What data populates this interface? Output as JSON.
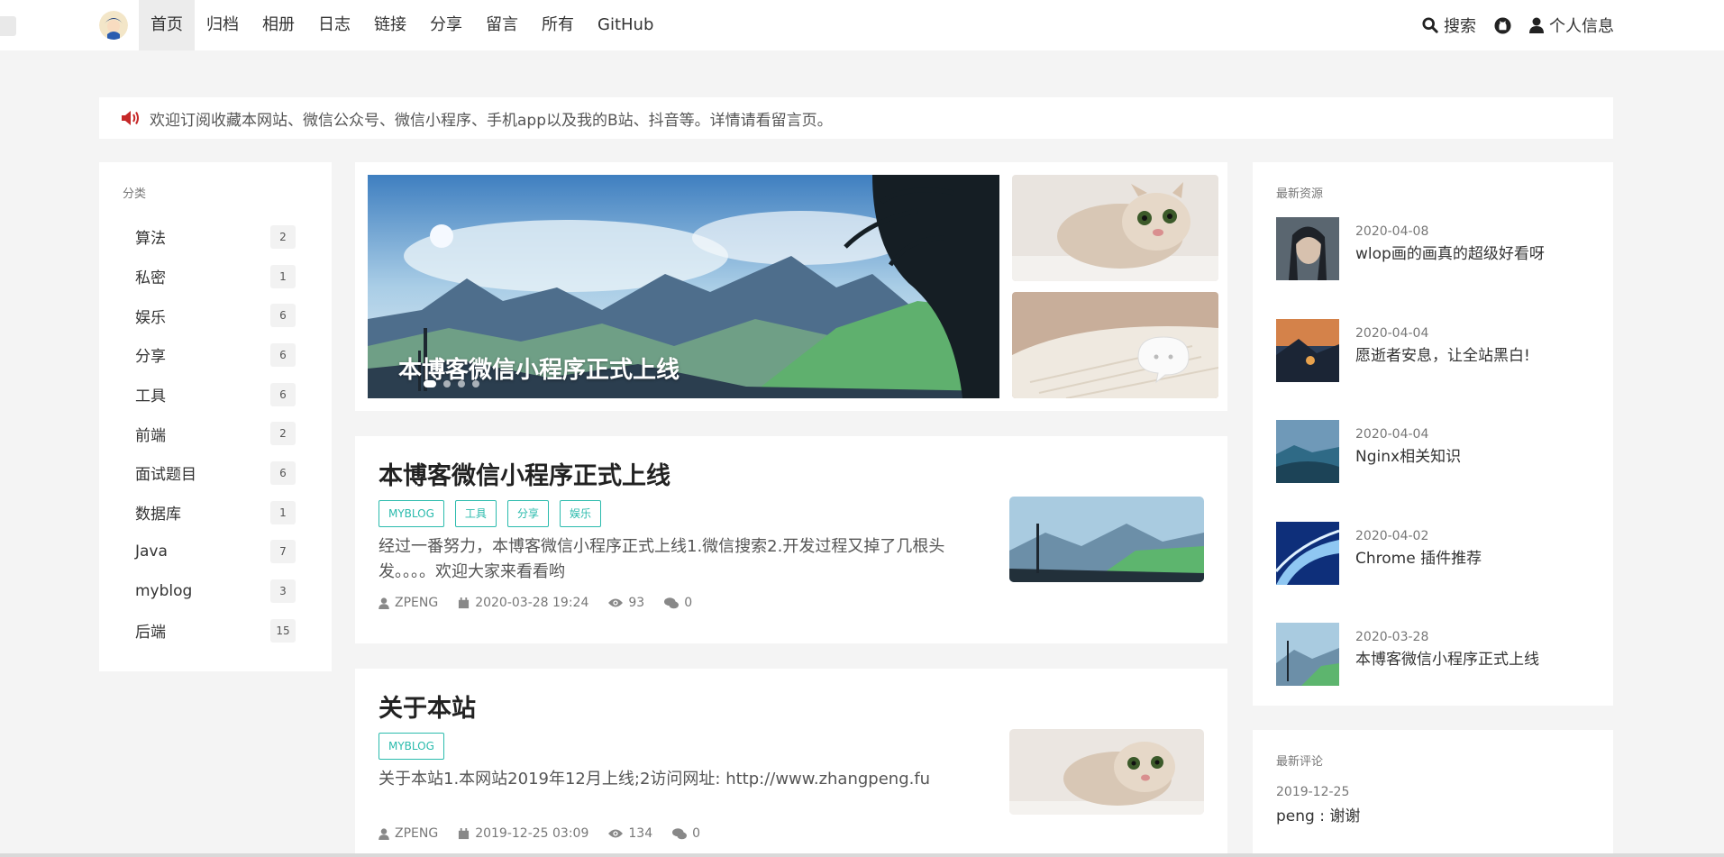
{
  "nav": {
    "items": [
      "首页",
      "归档",
      "相册",
      "日志",
      "链接",
      "分享",
      "留言",
      "所有",
      "GitHub"
    ],
    "search": "搜索",
    "profile": "个人信息"
  },
  "notice": {
    "text": "欢迎订阅收藏本网站、微信公众号、微信小程序、手机app以及我的B站、抖音等。详情请看留言页。"
  },
  "categories": {
    "title": "分类",
    "items": [
      {
        "name": "算法",
        "count": "2"
      },
      {
        "name": "私密",
        "count": "1"
      },
      {
        "name": "娱乐",
        "count": "6"
      },
      {
        "name": "分享",
        "count": "6"
      },
      {
        "name": "工具",
        "count": "6"
      },
      {
        "name": "前端",
        "count": "2"
      },
      {
        "name": "面试题目",
        "count": "6"
      },
      {
        "name": "数据库",
        "count": "1"
      },
      {
        "name": "Java",
        "count": "7"
      },
      {
        "name": "myblog",
        "count": "3"
      },
      {
        "name": "后端",
        "count": "15"
      }
    ]
  },
  "banner": {
    "caption": "本博客微信小程序正式上线"
  },
  "posts": [
    {
      "title": "本博客微信小程序正式上线",
      "tags": [
        "MYBLOG",
        "工具",
        "分享",
        "娱乐"
      ],
      "summary": "经过一番努力，本博客微信小程序正式上线1.微信搜索2.开发过程又掉了几根头发。。。。欢迎大家来看看哟",
      "author": "ZPENG",
      "date": "2020-03-28 19:24",
      "views": "93",
      "comments": "0"
    },
    {
      "title": "关于本站",
      "tags": [
        "MYBLOG"
      ],
      "summary": "关于本站1.本网站2019年12月上线;2访问网址:    http://www.zhangpeng.fu",
      "author": "ZPENG",
      "date": "2019-12-25 03:09",
      "views": "134",
      "comments": "0"
    }
  ],
  "resources": {
    "title": "最新资源",
    "items": [
      {
        "date": "2020-04-08",
        "title": "wlop画的画真的超级好看呀"
      },
      {
        "date": "2020-04-04",
        "title": "愿逝者安息，让全站黑白!"
      },
      {
        "date": "2020-04-04",
        "title": "Nginx相关知识"
      },
      {
        "date": "2020-04-02",
        "title": "Chrome 插件推荐"
      },
      {
        "date": "2020-03-28",
        "title": "本博客微信小程序正式上线"
      }
    ]
  },
  "comments": {
    "title": "最新评论",
    "items": [
      {
        "date": "2019-12-25",
        "text": "peng : 谢谢"
      }
    ]
  },
  "colors": {
    "accent": "#2bbbad",
    "notice_icon": "#c62828"
  },
  "icons": [
    "megaphone-icon",
    "search-icon",
    "github-icon",
    "user-icon",
    "calendar-icon",
    "eye-icon",
    "comments-icon"
  ]
}
